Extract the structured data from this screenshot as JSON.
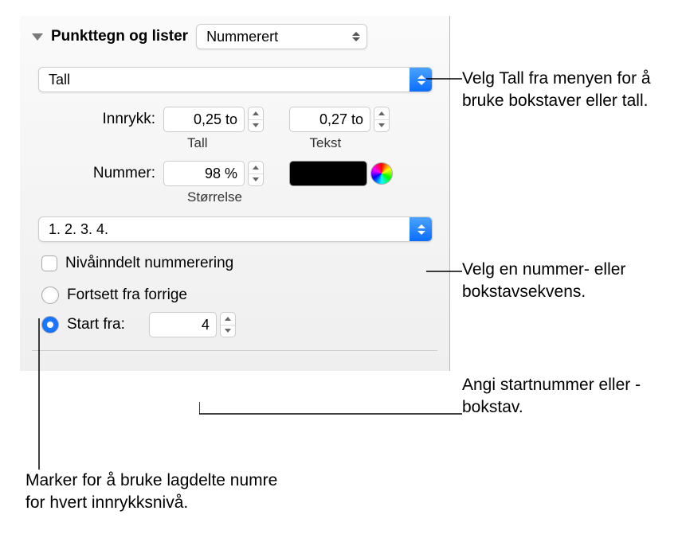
{
  "section": {
    "title": "Punkttegn og lister",
    "style_dropdown": "Nummerert"
  },
  "format_dropdown": "Tall",
  "indent": {
    "label": "Innrykk:",
    "number_value": "0,25 to",
    "number_sublabel": "Tall",
    "text_value": "0,27 to",
    "text_sublabel": "Tekst"
  },
  "number": {
    "label": "Nummer:",
    "size_value": "98 %",
    "size_sublabel": "Størrelse"
  },
  "sequence_dropdown": "1. 2. 3. 4.",
  "tiered": {
    "label": "Nivåinndelt nummerering"
  },
  "continue": {
    "label": "Fortsett fra forrige"
  },
  "start_from": {
    "label": "Start fra:",
    "value": "4"
  },
  "callouts": {
    "c1": "Velg Tall fra menyen for å bruke bokstaver eller tall.",
    "c2": "Velg en nummer- eller bokstavsekvens.",
    "c3": "Angi startnummer eller -bokstav.",
    "c4": "Marker for å bruke lagdelte numre for hvert innrykksnivå."
  }
}
